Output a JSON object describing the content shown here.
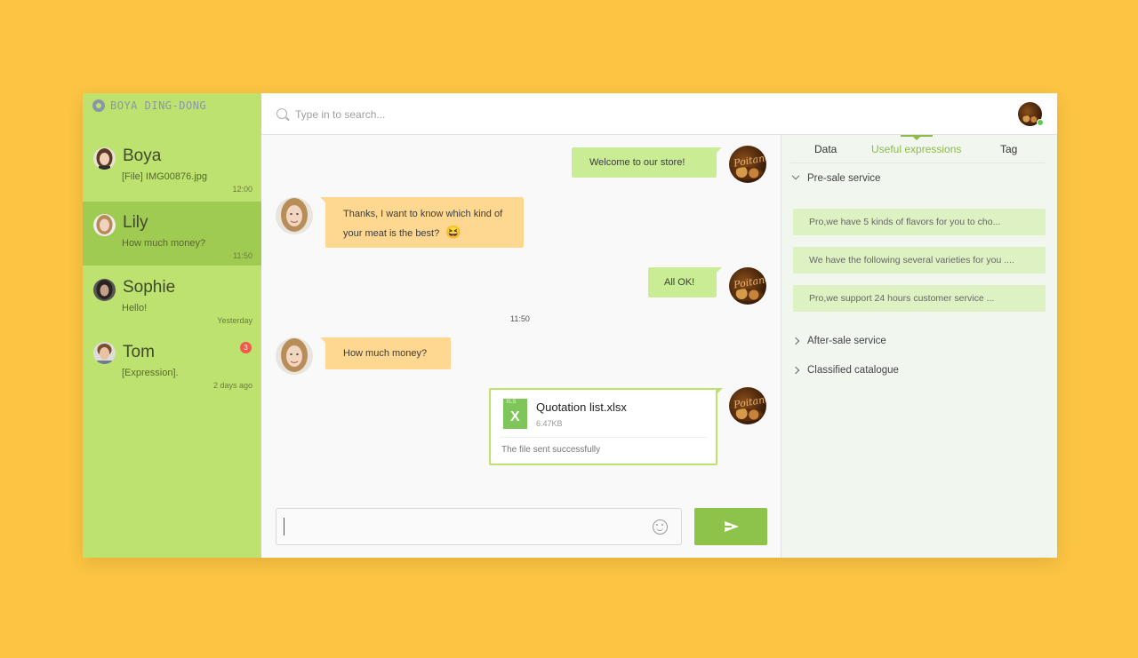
{
  "brand": {
    "name": "BOYA DING-DONG"
  },
  "conversations": [
    {
      "name": "Boya",
      "preview": "[File] IMG00876.jpg",
      "time": "12:00",
      "badge": ""
    },
    {
      "name": "Lily",
      "preview": "How much money?",
      "time": "11:50",
      "badge": ""
    },
    {
      "name": "Sophie",
      "preview": "Hello!",
      "time": "Yesterday",
      "badge": ""
    },
    {
      "name": "Tom",
      "preview": "[Expression].",
      "time": "2 days ago",
      "badge": "3"
    }
  ],
  "search": {
    "placeholder": "Type in to search..."
  },
  "messages": {
    "m1": "Welcome to our store!",
    "m2": "Thanks,  I want to know which kind of your meat is the best?",
    "m2_emoji": "😆",
    "m3": "All OK!",
    "divider_time": "11:50",
    "m4": "How much money?"
  },
  "file": {
    "type_tag": "XLS",
    "type_letter": "X",
    "name": "Quotation list.xlsx",
    "size": "6.47KB",
    "status": "The file sent successfully"
  },
  "store_avatar_text": "Poitane",
  "panel": {
    "tabs": [
      "Data",
      "Useful expressions",
      "Tag"
    ],
    "sections": [
      "Pre-sale service",
      "After-sale service",
      "Classified catalogue"
    ],
    "expressions": [
      "Pro,we have 5 kinds of flavors for you to cho...",
      "We have the following several varieties for you ....",
      "Pro,we support 24 hours customer service ..."
    ]
  },
  "colors": {
    "background": "#fcc442",
    "sidebar": "#bde270",
    "sidebar_active": "#a0cb52",
    "outgoing_bubble": "#c9ec95",
    "incoming_bubble": "#fed891",
    "accent": "#8dc24b",
    "badge": "#ee5b4a"
  },
  "icons": [
    "search-icon",
    "emoji-icon",
    "send-icon",
    "excel-file-icon",
    "chevron-down-icon",
    "chevron-right-icon"
  ]
}
